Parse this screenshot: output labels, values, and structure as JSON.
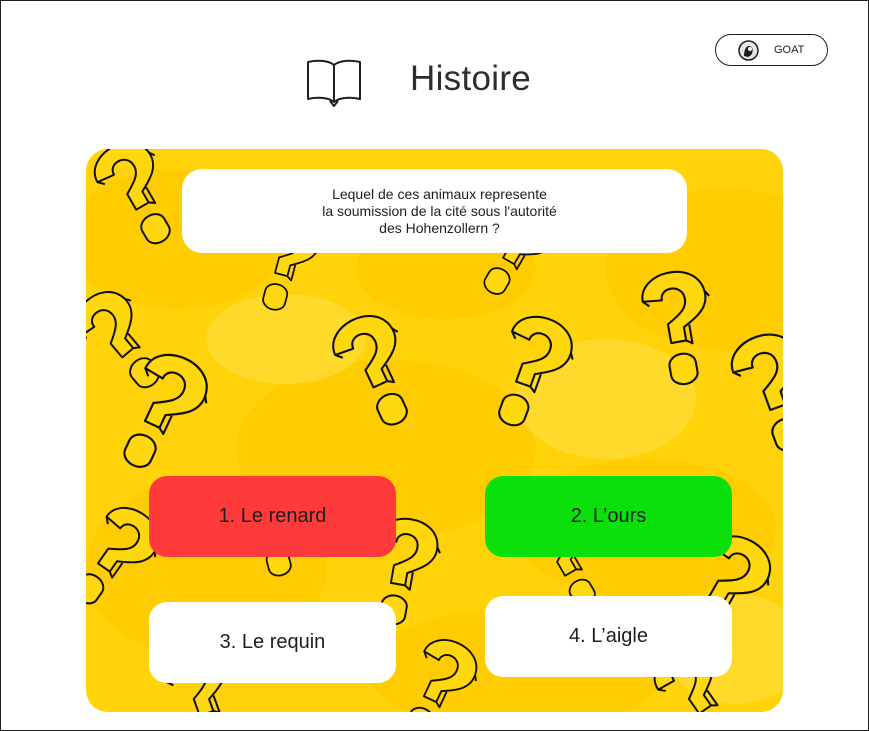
{
  "header": {
    "title": "Histoire",
    "book_icon": "open-book-icon"
  },
  "user": {
    "name": "GOAT",
    "avatar_icon": "avatar-icon"
  },
  "quiz": {
    "question_lines": [
      "Lequel de ces animaux represente",
      "la soumission de la cité sous l'autorité",
      "des Hohenzollern ?"
    ],
    "answers": [
      {
        "label": "1. Le renard",
        "state": "wrong",
        "color": "#ff3a3a"
      },
      {
        "label": "2. L’ours",
        "state": "correct",
        "color": "#0be00b"
      },
      {
        "label": "3. Le requin",
        "state": "neutral",
        "color": "#ffffff"
      },
      {
        "label": "4. L’aigle",
        "state": "neutral",
        "color": "#ffffff"
      }
    ],
    "background_color": "#ffd20a",
    "pattern_icon": "question-mark-pattern-icon"
  }
}
